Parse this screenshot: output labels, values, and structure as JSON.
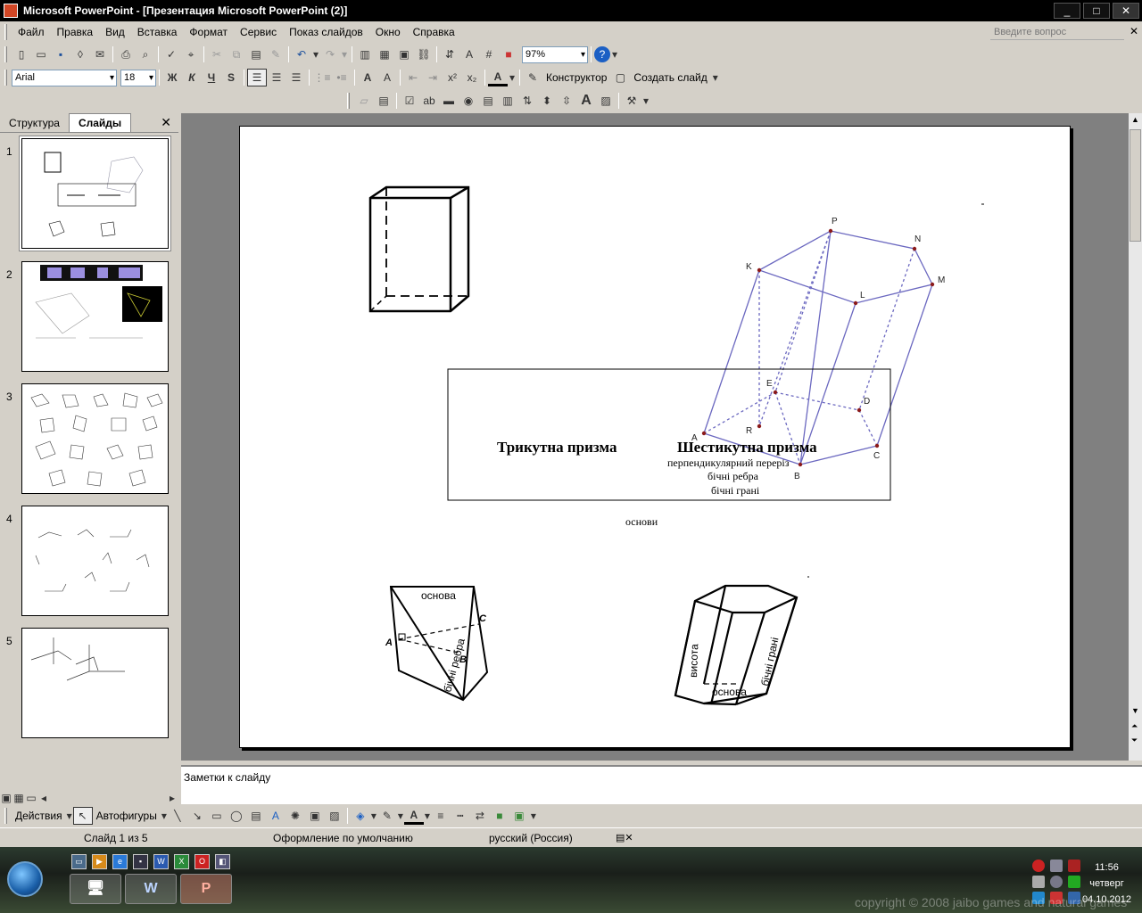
{
  "window": {
    "title": "Microsoft PowerPoint - [Презентация Microsoft PowerPoint (2)]",
    "minimize": "_",
    "maximize": "□",
    "close": "✕"
  },
  "menu": {
    "items": [
      "Файл",
      "Правка",
      "Вид",
      "Вставка",
      "Формат",
      "Сервис",
      "Показ слайдов",
      "Окно",
      "Справка"
    ],
    "ask_placeholder": "Введите вопрос",
    "close": "✕"
  },
  "toolbar_standard": {
    "zoom": "97%"
  },
  "toolbar_formatting": {
    "font": "Arial",
    "size": "18",
    "bold": "Ж",
    "italic": "К",
    "underline": "Ч",
    "shadow": "S",
    "grow_font": "A",
    "shrink_font": "A",
    "superscript": "x²",
    "subscript": "x₂",
    "font_color": "A",
    "designer": "Конструктор",
    "new_slide": "Создать слайд"
  },
  "left_pane": {
    "tab_outline": "Структура",
    "tab_slides": "Слайды",
    "close": "✕",
    "slide_numbers": [
      "1",
      "2",
      "3",
      "4",
      "5"
    ]
  },
  "slide": {
    "label_triangular": "Трикутна призма",
    "label_hexagonal": "Шестикутна призма",
    "label_cross_section": "перпендикулярний  переріз",
    "label_lateral_edges": "бічні ребра",
    "label_lateral_faces": "бічні грані",
    "label_bases": "основи",
    "vertices": [
      "P",
      "N",
      "K",
      "L",
      "M",
      "E",
      "D",
      "R",
      "A",
      "B",
      "C"
    ],
    "tri_prism": {
      "base": "основа",
      "edges": "бічні ребра",
      "A": "A",
      "B": "B",
      "C": "C"
    },
    "hex_prism": {
      "height": "висота",
      "base": "основа",
      "faces": "бічні грані"
    }
  },
  "notes": {
    "placeholder": "Заметки к слайду"
  },
  "drawing_toolbar": {
    "actions": "Действия",
    "autoshapes": "Автофигуры"
  },
  "status": {
    "slide_of": "Слайд 1 из 5",
    "design": "Оформление по умолчанию",
    "language": "русский (Россия)"
  },
  "taskbar": {
    "time": "11:56",
    "day": "четверг",
    "date": "04.10.2012",
    "watermark": "copyright © 2008 jaibo games and natural games",
    "word_btn": "W",
    "ppt_btn": "P"
  }
}
